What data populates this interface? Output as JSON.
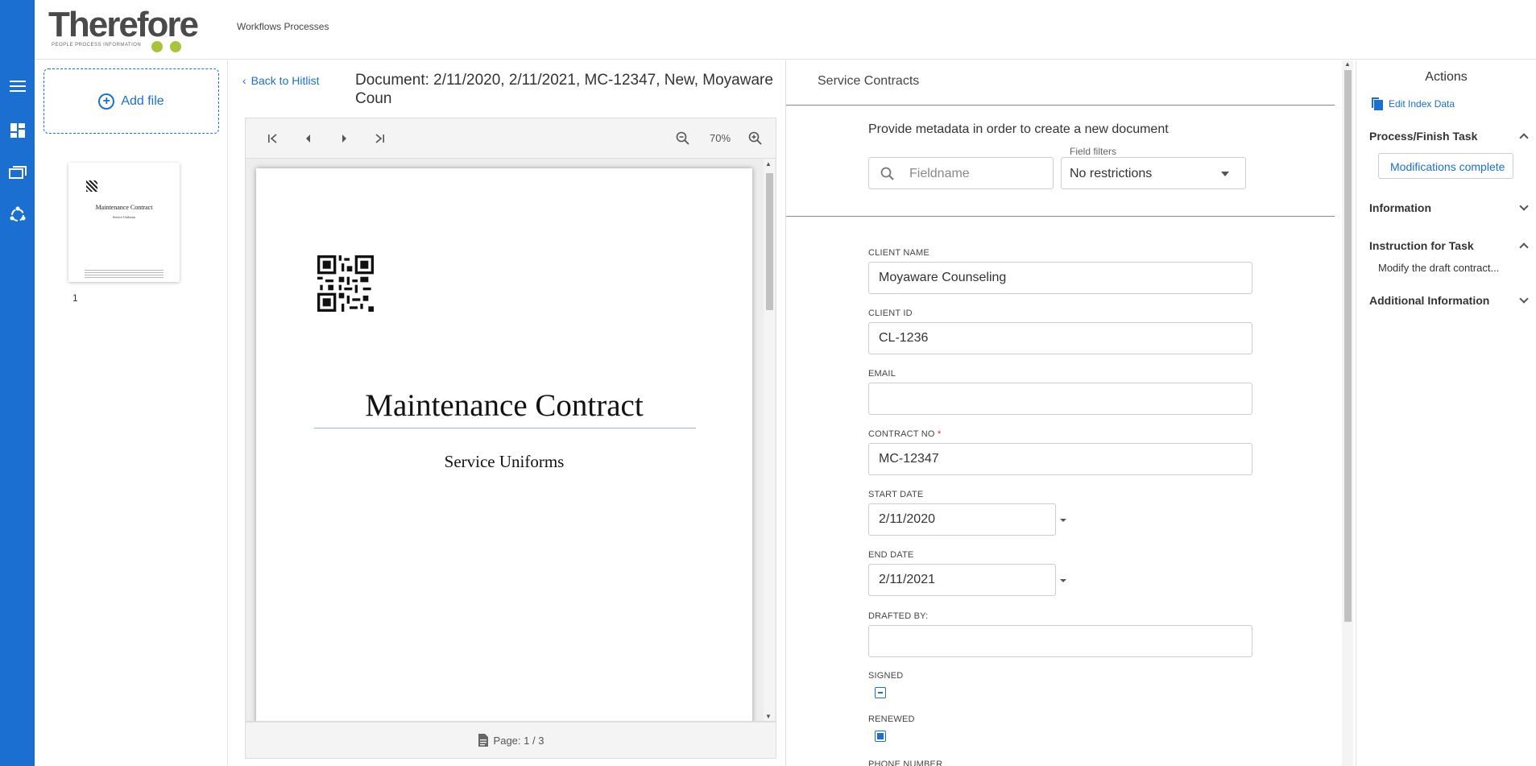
{
  "app": {
    "logo_text": "Therefore",
    "logo_tagline": "PEOPLE  PROCESS  INFORMATION",
    "nav_link": "Workflows Processes",
    "brand_color": "#1a6fd1"
  },
  "rail": {
    "icons": [
      "menu-icon",
      "dashboard-icon",
      "folders-icon",
      "workflow-icon"
    ]
  },
  "files": {
    "add_label": "Add file",
    "thumb_title": "Maintenance Contract",
    "thumb_subtitle": "Service Uniforms",
    "page_number": "1"
  },
  "viewer": {
    "back_label": "Back to Hitlist",
    "title": "Document: 2/11/2020, 2/11/2021, MC-12347, New, Moyaware Coun",
    "zoom": "70%",
    "page_title": "Maintenance Contract",
    "page_subtitle": "Service Uniforms",
    "page_indicator": "Page: 1 / 3"
  },
  "form": {
    "category": "Service Contracts",
    "instruction": "Provide metadata in order to create a new document",
    "search_placeholder": "Fieldname",
    "filter_label": "Field filters",
    "filter_value": "No restrictions",
    "fields": {
      "client_name": {
        "label": "CLIENT NAME",
        "value": "Moyaware Counseling"
      },
      "client_id": {
        "label": "CLIENT ID",
        "value": "CL-1236"
      },
      "email": {
        "label": "EMAIL",
        "value": ""
      },
      "contract_no": {
        "label": "CONTRACT NO",
        "value": "MC-12347",
        "required": "*"
      },
      "start_date": {
        "label": "START DATE",
        "value": "2/11/2020"
      },
      "end_date": {
        "label": "END DATE",
        "value": "2/11/2021"
      },
      "drafted_by": {
        "label": "DRAFTED BY:",
        "value": ""
      },
      "signed": {
        "label": "SIGNED",
        "state": "indeterminate"
      },
      "renewed": {
        "label": "RENEWED",
        "state": "checked"
      },
      "phone": {
        "label": "PHONE NUMBER"
      }
    }
  },
  "actions": {
    "title": "Actions",
    "edit_index": "Edit Index Data",
    "process_finish": "Process/Finish Task",
    "modifications_button": "Modifications complete",
    "information": "Information",
    "instruction_for_task": "Instruction for Task",
    "instruction_text": "Modify the draft contract...",
    "additional_information": "Additional Information"
  }
}
